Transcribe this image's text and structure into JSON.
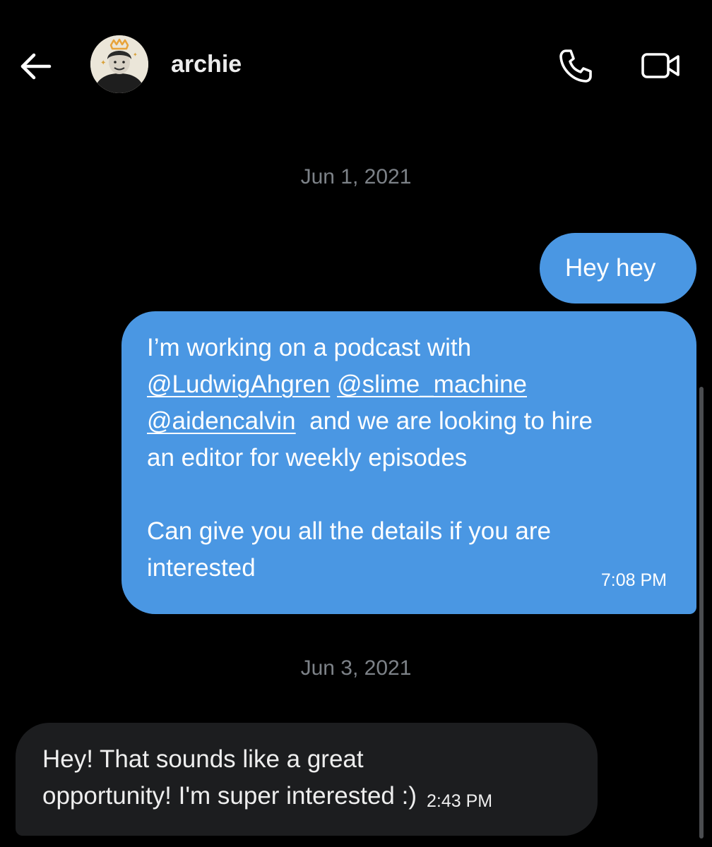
{
  "header": {
    "back_icon": "arrow-left-icon",
    "contact_name": "archie",
    "call_icon": "phone-icon",
    "video_icon": "video-camera-icon"
  },
  "conversation": {
    "date_1": "Jun 1, 2021",
    "date_2": "Jun 3, 2021",
    "msg_1": {
      "text": "Hey hey"
    },
    "msg_2": {
      "line_1": "I’m working on a podcast with",
      "mention_1": "@LudwigAhgren",
      "mention_2": "@slime_machine",
      "mention_3": "@aidencalvin",
      "line_3_rest": "and we are looking to hire",
      "line_4": "an editor for weekly episodes",
      "line_5": "Can give you all the details if you are",
      "line_6": "interested",
      "time": "7:08 PM"
    },
    "msg_3": {
      "line_1": "Hey! That sounds like a great",
      "line_2": "opportunity! I'm super interested :)",
      "time": "2:43 PM"
    }
  },
  "colors": {
    "background": "#000000",
    "outgoing_bubble": "#4a97e3",
    "incoming_bubble": "#1c1d1f",
    "date_text": "#7d8288"
  }
}
